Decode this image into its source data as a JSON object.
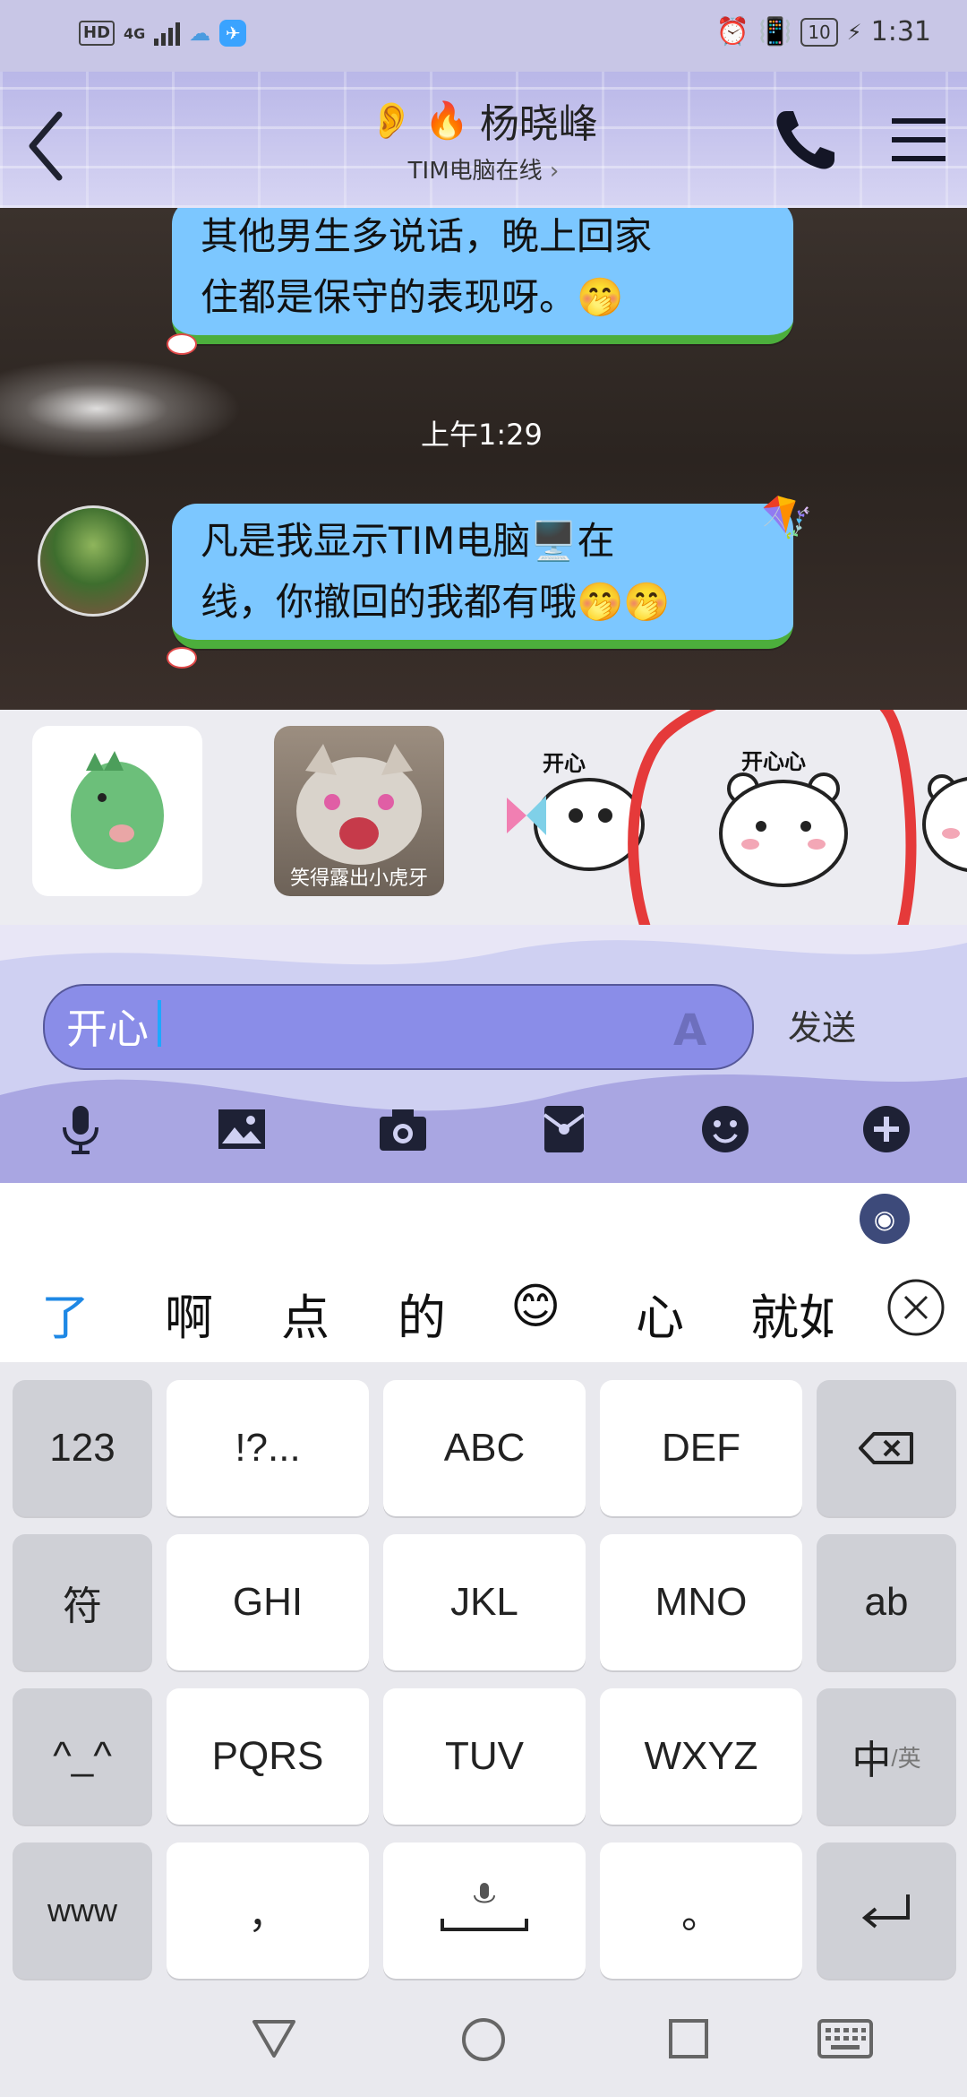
{
  "status_bar": {
    "network_label": "HD",
    "signal_label": "4G",
    "battery": "10",
    "time": "1:31"
  },
  "header": {
    "contact_name": "杨晓峰",
    "subtitle": "TIM电脑在线",
    "subtitle_chevron": "›"
  },
  "chat": {
    "messages": [
      {
        "text_line1": "其他男生多说话，晚上回家",
        "text_line2": "住都是保守的表现呀。🤭"
      },
      {
        "timestamp": "上午1:29"
      },
      {
        "text_line1": "凡是我显示TIM电脑🖥️在",
        "text_line2": "线，你撤回的我都有哦🤭🤭"
      }
    ]
  },
  "sticker_strip": {
    "items": [
      {
        "name": "green-dinosaur"
      },
      {
        "name": "laughing-cat",
        "label": "笑得露出小虎牙"
      },
      {
        "name": "white-blob-pinwheel",
        "caption": "开心"
      },
      {
        "name": "white-bear",
        "caption": "开心心"
      },
      {
        "name": "partial-bear"
      }
    ]
  },
  "composer": {
    "input_value": "开心",
    "send_label": "发送"
  },
  "toolbar": {
    "icons": [
      "microphone-icon",
      "image-icon",
      "camera-icon",
      "red-packet-icon",
      "emoji-icon",
      "plus-icon"
    ]
  },
  "candidates": {
    "items": [
      "了",
      "啊",
      "点",
      "的",
      "😊",
      "心",
      "就如"
    ]
  },
  "keyboard": {
    "rows": [
      [
        "123",
        "!?...",
        "ABC",
        "DEF",
        "⌫"
      ],
      [
        "符",
        "GHI",
        "JKL",
        "MNO",
        "ab"
      ],
      [
        "^_^",
        "PQRS",
        "TUV",
        "WXYZ",
        "中/英"
      ],
      [
        "www",
        "，",
        "␣",
        "。",
        "↵"
      ]
    ],
    "lang_main": "中",
    "lang_sub": "/英"
  },
  "colors": {
    "header_bg": "#c8c6e6",
    "bubble": "#7cc7ff",
    "input_bg": "#8a8de8",
    "annotation": "#e53a3a"
  }
}
